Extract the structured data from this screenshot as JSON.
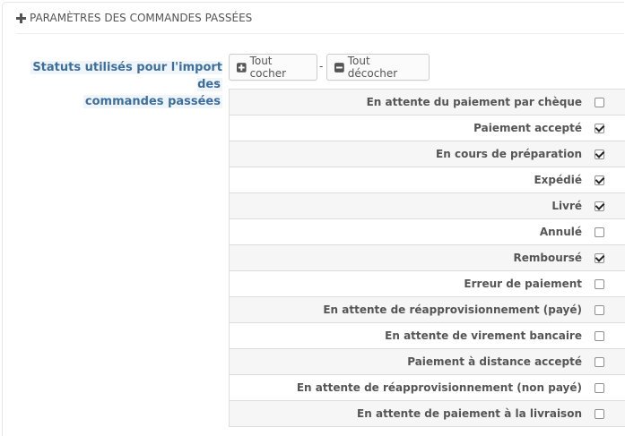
{
  "panel": {
    "title": "PARAMÈTRES DES COMMANDES PASSÉES"
  },
  "form": {
    "label_line1": "Statuts utilisés pour l'import des",
    "label_line2": "commandes passées",
    "label_colon": ":",
    "check_all": "Tout cocher",
    "separator": "-",
    "uncheck_all": "Tout décocher"
  },
  "statuses": [
    {
      "label": "En attente du paiement par chèque",
      "checked": false
    },
    {
      "label": "Paiement accepté",
      "checked": true
    },
    {
      "label": "En cours de préparation",
      "checked": true
    },
    {
      "label": "Expédié",
      "checked": true
    },
    {
      "label": "Livré",
      "checked": true
    },
    {
      "label": "Annulé",
      "checked": false
    },
    {
      "label": "Remboursé",
      "checked": true
    },
    {
      "label": "Erreur de paiement",
      "checked": false
    },
    {
      "label": "En attente de réapprovisionnement (payé)",
      "checked": false
    },
    {
      "label": "En attente de virement bancaire",
      "checked": false
    },
    {
      "label": "Paiement à distance accepté",
      "checked": false
    },
    {
      "label": "En attente de réapprovisionnement (non payé)",
      "checked": false
    },
    {
      "label": "En attente de paiement à la livraison",
      "checked": false
    }
  ],
  "colors": {
    "label_text": "#3d6f9e",
    "label_bg": "#f0f5fa",
    "row_alt": "#f6f6f6"
  },
  "icons": {
    "heading": "plus-icon",
    "check_all": "plus-square-icon",
    "uncheck_all": "minus-square-icon"
  }
}
